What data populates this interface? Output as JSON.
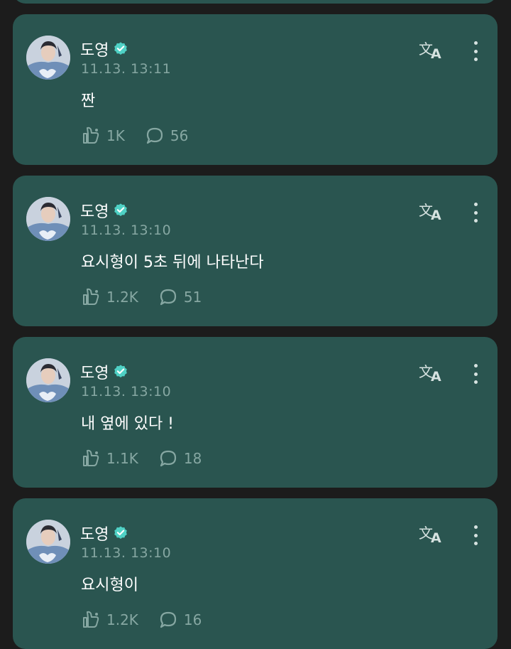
{
  "colors": {
    "card_bg": "#2a5550",
    "page_bg": "#1c1c1c",
    "verified": "#4fd1c5",
    "muted_text": "#86a7a2"
  },
  "posts": [
    {
      "author": "도영",
      "timestamp": "11.13. 13:11",
      "text": "짠",
      "likes": "1K",
      "comments": "56"
    },
    {
      "author": "도영",
      "timestamp": "11.13. 13:10",
      "text": "요시형이 5초 뒤에 나타난다",
      "likes": "1.2K",
      "comments": "51"
    },
    {
      "author": "도영",
      "timestamp": "11.13. 13:10",
      "text": "내 옆에 있다 !",
      "likes": "1.1K",
      "comments": "18"
    },
    {
      "author": "도영",
      "timestamp": "11.13. 13:10",
      "text": "요시형이",
      "likes": "1.2K",
      "comments": "16"
    }
  ],
  "icons": {
    "translate": "translate-icon",
    "more": "more-vertical-icon",
    "like": "like-icon",
    "comment": "comment-icon",
    "verified": "verified-badge-icon"
  }
}
